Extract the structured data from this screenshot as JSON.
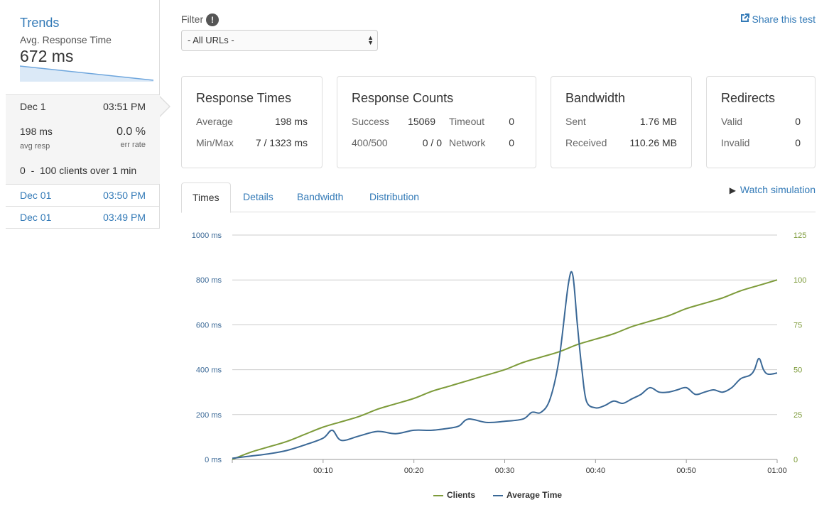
{
  "sidebar": {
    "title": "Trends",
    "avg_label": "Avg. Response Time",
    "avg_value": "672 ms",
    "current": {
      "date": "Dec 1",
      "time": "03:51 PM",
      "resp": "198 ms",
      "resp_label": "avg resp",
      "err": "0.0 %",
      "err_label": "err rate",
      "clients": "0  -  100 clients over 1 min"
    },
    "runs": [
      {
        "date": "Dec 01",
        "time": "03:50 PM"
      },
      {
        "date": "Dec 01",
        "time": "03:49 PM"
      }
    ]
  },
  "filter": {
    "label": "Filter",
    "info_glyph": "!",
    "selected": "- All URLs -"
  },
  "share_label": "Share this test",
  "boxes": {
    "response_times": {
      "title": "Response Times",
      "avg_label": "Average",
      "avg": "198 ms",
      "minmax_label": "Min/Max",
      "minmax": "7 / 1323 ms"
    },
    "response_counts": {
      "title": "Response Counts",
      "success_label": "Success",
      "success": "15069",
      "timeout_label": "Timeout",
      "timeout": "0",
      "errors_label": "400/500",
      "errors": "0 / 0",
      "network_label": "Network",
      "network": "0"
    },
    "bandwidth": {
      "title": "Bandwidth",
      "sent_label": "Sent",
      "sent": "1.76 MB",
      "received_label": "Received",
      "received": "110.26 MB"
    },
    "redirects": {
      "title": "Redirects",
      "valid_label": "Valid",
      "valid": "0",
      "invalid_label": "Invalid",
      "invalid": "0"
    }
  },
  "tabs": [
    {
      "label": "Times",
      "active": true
    },
    {
      "label": "Details",
      "active": false
    },
    {
      "label": "Bandwidth",
      "active": false
    },
    {
      "label": "Distribution",
      "active": false
    }
  ],
  "watch_label": "Watch simulation",
  "colors": {
    "clients": "#7d9b3a",
    "avg_time": "#3a6896",
    "accent": "#337ab7"
  },
  "chart_data": {
    "type": "line",
    "x_ticks": [
      "00:10",
      "00:20",
      "00:30",
      "00:40",
      "00:50",
      "01:00"
    ],
    "y_left_ticks": [
      "0 ms",
      "200 ms",
      "400 ms",
      "600 ms",
      "800 ms",
      "1000 ms"
    ],
    "y_right_ticks": [
      "0",
      "25",
      "50",
      "75",
      "100",
      "125"
    ],
    "ylim_left": [
      0,
      1000
    ],
    "ylim_right": [
      0,
      125
    ],
    "xlim": [
      0,
      60
    ],
    "grid": true,
    "legend_placement": "bottom",
    "series": [
      {
        "name": "Clients",
        "axis": "right",
        "x": [
          0,
          2,
          4,
          6,
          8,
          10,
          12,
          14,
          16,
          18,
          20,
          22,
          24,
          26,
          28,
          30,
          32,
          34,
          36,
          38,
          40,
          42,
          44,
          46,
          48,
          50,
          52,
          54,
          56,
          58,
          60
        ],
        "y": [
          0,
          4,
          7,
          10,
          14,
          18,
          21,
          24,
          28,
          31,
          34,
          38,
          41,
          44,
          47,
          50,
          54,
          57,
          60,
          64,
          67,
          70,
          74,
          77,
          80,
          84,
          87,
          90,
          94,
          97,
          100
        ]
      },
      {
        "name": "Average Time",
        "axis": "left",
        "x": [
          0,
          2,
          4,
          6,
          8,
          10,
          11,
          12,
          14,
          16,
          18,
          20,
          22,
          24,
          25,
          26,
          28,
          30,
          32,
          33,
          34,
          35,
          36,
          37,
          37.5,
          38,
          38.5,
          39,
          40,
          41,
          42,
          43,
          44,
          45,
          46,
          47,
          48,
          49,
          50,
          51,
          52,
          53,
          54,
          55,
          56,
          57,
          57.5,
          58,
          58.5,
          59,
          60
        ],
        "y": [
          5,
          15,
          25,
          40,
          65,
          95,
          130,
          85,
          105,
          125,
          115,
          130,
          130,
          140,
          150,
          180,
          165,
          170,
          180,
          210,
          210,
          270,
          450,
          780,
          820,
          600,
          400,
          260,
          230,
          240,
          260,
          250,
          270,
          290,
          320,
          300,
          300,
          310,
          320,
          290,
          300,
          310,
          300,
          320,
          360,
          375,
          400,
          450,
          400,
          380,
          385
        ]
      }
    ]
  }
}
